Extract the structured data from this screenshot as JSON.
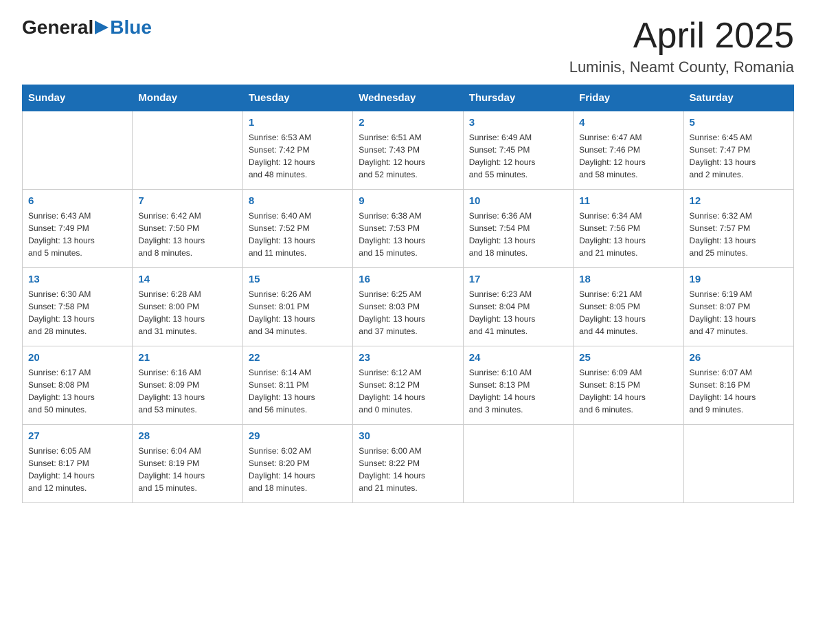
{
  "header": {
    "logo_general": "General",
    "logo_blue": "Blue",
    "month_title": "April 2025",
    "location": "Luminis, Neamt County, Romania"
  },
  "weekdays": [
    "Sunday",
    "Monday",
    "Tuesday",
    "Wednesday",
    "Thursday",
    "Friday",
    "Saturday"
  ],
  "weeks": [
    [
      {
        "day": "",
        "info": ""
      },
      {
        "day": "",
        "info": ""
      },
      {
        "day": "1",
        "info": "Sunrise: 6:53 AM\nSunset: 7:42 PM\nDaylight: 12 hours\nand 48 minutes."
      },
      {
        "day": "2",
        "info": "Sunrise: 6:51 AM\nSunset: 7:43 PM\nDaylight: 12 hours\nand 52 minutes."
      },
      {
        "day": "3",
        "info": "Sunrise: 6:49 AM\nSunset: 7:45 PM\nDaylight: 12 hours\nand 55 minutes."
      },
      {
        "day": "4",
        "info": "Sunrise: 6:47 AM\nSunset: 7:46 PM\nDaylight: 12 hours\nand 58 minutes."
      },
      {
        "day": "5",
        "info": "Sunrise: 6:45 AM\nSunset: 7:47 PM\nDaylight: 13 hours\nand 2 minutes."
      }
    ],
    [
      {
        "day": "6",
        "info": "Sunrise: 6:43 AM\nSunset: 7:49 PM\nDaylight: 13 hours\nand 5 minutes."
      },
      {
        "day": "7",
        "info": "Sunrise: 6:42 AM\nSunset: 7:50 PM\nDaylight: 13 hours\nand 8 minutes."
      },
      {
        "day": "8",
        "info": "Sunrise: 6:40 AM\nSunset: 7:52 PM\nDaylight: 13 hours\nand 11 minutes."
      },
      {
        "day": "9",
        "info": "Sunrise: 6:38 AM\nSunset: 7:53 PM\nDaylight: 13 hours\nand 15 minutes."
      },
      {
        "day": "10",
        "info": "Sunrise: 6:36 AM\nSunset: 7:54 PM\nDaylight: 13 hours\nand 18 minutes."
      },
      {
        "day": "11",
        "info": "Sunrise: 6:34 AM\nSunset: 7:56 PM\nDaylight: 13 hours\nand 21 minutes."
      },
      {
        "day": "12",
        "info": "Sunrise: 6:32 AM\nSunset: 7:57 PM\nDaylight: 13 hours\nand 25 minutes."
      }
    ],
    [
      {
        "day": "13",
        "info": "Sunrise: 6:30 AM\nSunset: 7:58 PM\nDaylight: 13 hours\nand 28 minutes."
      },
      {
        "day": "14",
        "info": "Sunrise: 6:28 AM\nSunset: 8:00 PM\nDaylight: 13 hours\nand 31 minutes."
      },
      {
        "day": "15",
        "info": "Sunrise: 6:26 AM\nSunset: 8:01 PM\nDaylight: 13 hours\nand 34 minutes."
      },
      {
        "day": "16",
        "info": "Sunrise: 6:25 AM\nSunset: 8:03 PM\nDaylight: 13 hours\nand 37 minutes."
      },
      {
        "day": "17",
        "info": "Sunrise: 6:23 AM\nSunset: 8:04 PM\nDaylight: 13 hours\nand 41 minutes."
      },
      {
        "day": "18",
        "info": "Sunrise: 6:21 AM\nSunset: 8:05 PM\nDaylight: 13 hours\nand 44 minutes."
      },
      {
        "day": "19",
        "info": "Sunrise: 6:19 AM\nSunset: 8:07 PM\nDaylight: 13 hours\nand 47 minutes."
      }
    ],
    [
      {
        "day": "20",
        "info": "Sunrise: 6:17 AM\nSunset: 8:08 PM\nDaylight: 13 hours\nand 50 minutes."
      },
      {
        "day": "21",
        "info": "Sunrise: 6:16 AM\nSunset: 8:09 PM\nDaylight: 13 hours\nand 53 minutes."
      },
      {
        "day": "22",
        "info": "Sunrise: 6:14 AM\nSunset: 8:11 PM\nDaylight: 13 hours\nand 56 minutes."
      },
      {
        "day": "23",
        "info": "Sunrise: 6:12 AM\nSunset: 8:12 PM\nDaylight: 14 hours\nand 0 minutes."
      },
      {
        "day": "24",
        "info": "Sunrise: 6:10 AM\nSunset: 8:13 PM\nDaylight: 14 hours\nand 3 minutes."
      },
      {
        "day": "25",
        "info": "Sunrise: 6:09 AM\nSunset: 8:15 PM\nDaylight: 14 hours\nand 6 minutes."
      },
      {
        "day": "26",
        "info": "Sunrise: 6:07 AM\nSunset: 8:16 PM\nDaylight: 14 hours\nand 9 minutes."
      }
    ],
    [
      {
        "day": "27",
        "info": "Sunrise: 6:05 AM\nSunset: 8:17 PM\nDaylight: 14 hours\nand 12 minutes."
      },
      {
        "day": "28",
        "info": "Sunrise: 6:04 AM\nSunset: 8:19 PM\nDaylight: 14 hours\nand 15 minutes."
      },
      {
        "day": "29",
        "info": "Sunrise: 6:02 AM\nSunset: 8:20 PM\nDaylight: 14 hours\nand 18 minutes."
      },
      {
        "day": "30",
        "info": "Sunrise: 6:00 AM\nSunset: 8:22 PM\nDaylight: 14 hours\nand 21 minutes."
      },
      {
        "day": "",
        "info": ""
      },
      {
        "day": "",
        "info": ""
      },
      {
        "day": "",
        "info": ""
      }
    ]
  ]
}
